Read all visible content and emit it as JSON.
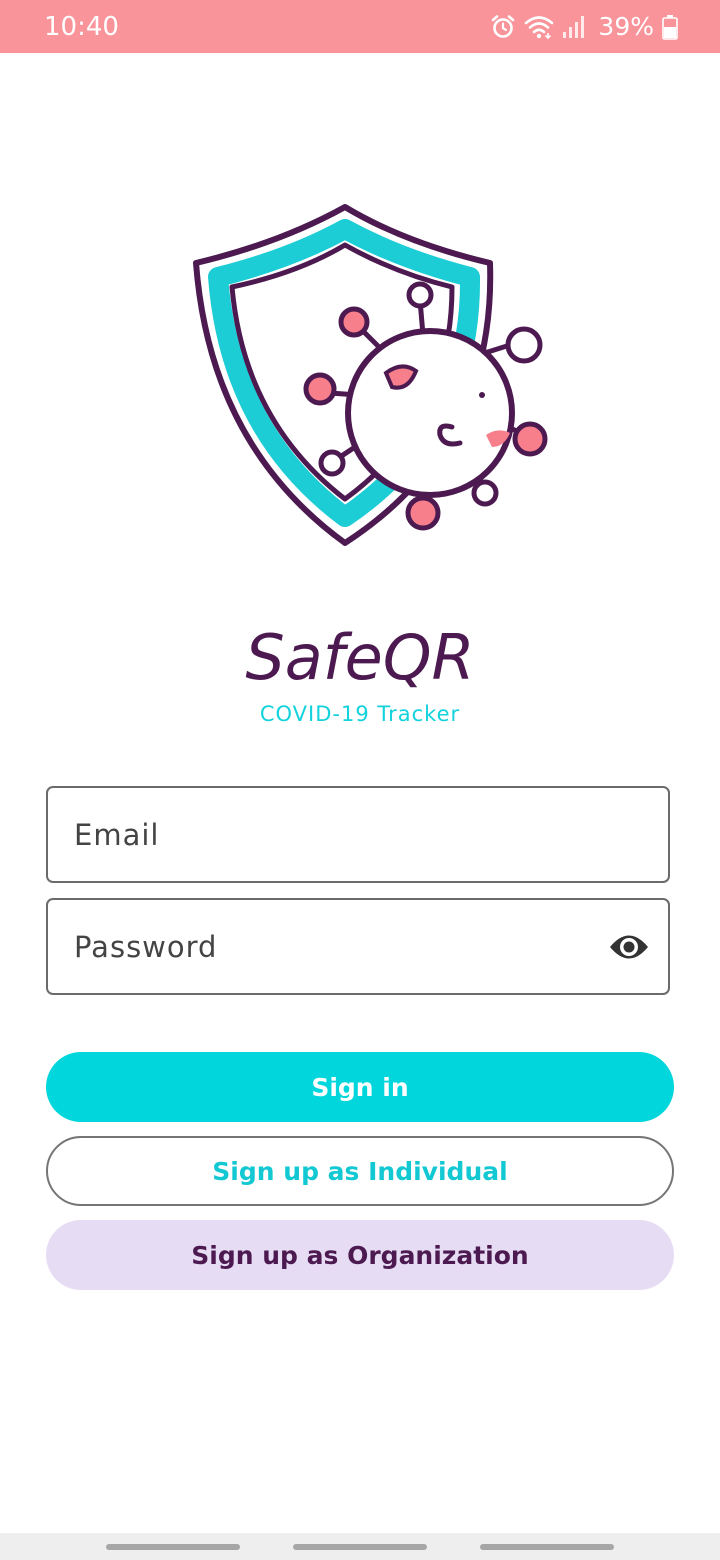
{
  "status_bar": {
    "time": "10:40",
    "battery_percent": "39%",
    "icons": [
      "alarm-icon",
      "wifi-icon",
      "signal-icon",
      "battery-icon"
    ]
  },
  "app": {
    "title": "SafeQR",
    "subtitle": "COVID-19 Tracker",
    "logo": "shield-virus-logo"
  },
  "form": {
    "email_placeholder": "Email",
    "email_value": "",
    "password_placeholder": "Password",
    "password_value": "",
    "password_toggle_icon": "eye-icon"
  },
  "buttons": {
    "sign_in": "Sign in",
    "sign_up_individual": "Sign up as Individual",
    "sign_up_organization": "Sign up as Organization"
  },
  "colors": {
    "status_bar": "#f9949b",
    "brand_purple": "#4c1a50",
    "brand_cyan": "#00d6dc",
    "org_button_bg": "#e6dcf4",
    "virus_pink": "#f77f8c"
  }
}
